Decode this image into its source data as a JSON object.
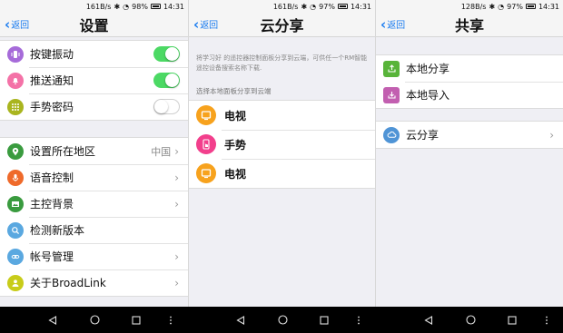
{
  "panels": [
    {
      "status": {
        "speed": "161B/s",
        "battery": "98%",
        "time": "14:31"
      },
      "back_label": "返回",
      "title": "设置",
      "group1": [
        {
          "label": "按键振动",
          "toggle": true,
          "icon": "vibrate-icon",
          "color": "#a66bd9"
        },
        {
          "label": "推送通知",
          "toggle": true,
          "icon": "bell-icon",
          "color": "#f472a7"
        },
        {
          "label": "手势密码",
          "toggle": false,
          "icon": "keypad-icon",
          "color": "#a9b51f"
        }
      ],
      "group2": [
        {
          "label": "设置所在地区",
          "value": "中国",
          "icon": "location-icon",
          "color": "#3a9b3f"
        },
        {
          "label": "语音控制",
          "icon": "microphone-icon",
          "color": "#ef6a2b"
        },
        {
          "label": "主控背景",
          "icon": "image-icon",
          "color": "#3a9b3f"
        },
        {
          "label": "检测新版本",
          "icon": "search-icon",
          "color": "#5aa8e0"
        },
        {
          "label": "帐号管理",
          "icon": "link-icon",
          "color": "#5aa8e0"
        },
        {
          "label": "关于BroadLink",
          "icon": "person-icon",
          "color": "#c8cc1a"
        }
      ]
    },
    {
      "status": {
        "speed": "161B/s",
        "battery": "97%",
        "time": "14:31"
      },
      "back_label": "返回",
      "title": "云分享",
      "description": "将学习好 的遥控器控制面板分享到云端，可供任一个RM智能遥控设备搜索名称下载.",
      "section_header": "选择本地面板分享到云端",
      "items": [
        {
          "label": "电视",
          "icon": "tv-icon",
          "color": "#f7a21d"
        },
        {
          "label": "手势",
          "icon": "hand-gesture-icon",
          "color": "#f23f8c"
        },
        {
          "label": "电视",
          "icon": "tv-icon",
          "color": "#f7a21d"
        }
      ]
    },
    {
      "status": {
        "speed": "128B/s",
        "battery": "97%",
        "time": "14:31"
      },
      "back_label": "返回",
      "title": "共享",
      "group1": [
        {
          "label": "本地分享",
          "icon": "upload-icon",
          "color": "#58b43a"
        },
        {
          "label": "本地导入",
          "icon": "download-icon",
          "color": "#c25fb0"
        }
      ],
      "group2": [
        {
          "label": "云分享",
          "icon": "cloud-icon",
          "color": "#4f94d6"
        }
      ]
    }
  ],
  "nav_buttons": [
    "back-triangle-icon",
    "home-circle-icon",
    "recents-square-icon",
    "menu-dots-icon"
  ]
}
